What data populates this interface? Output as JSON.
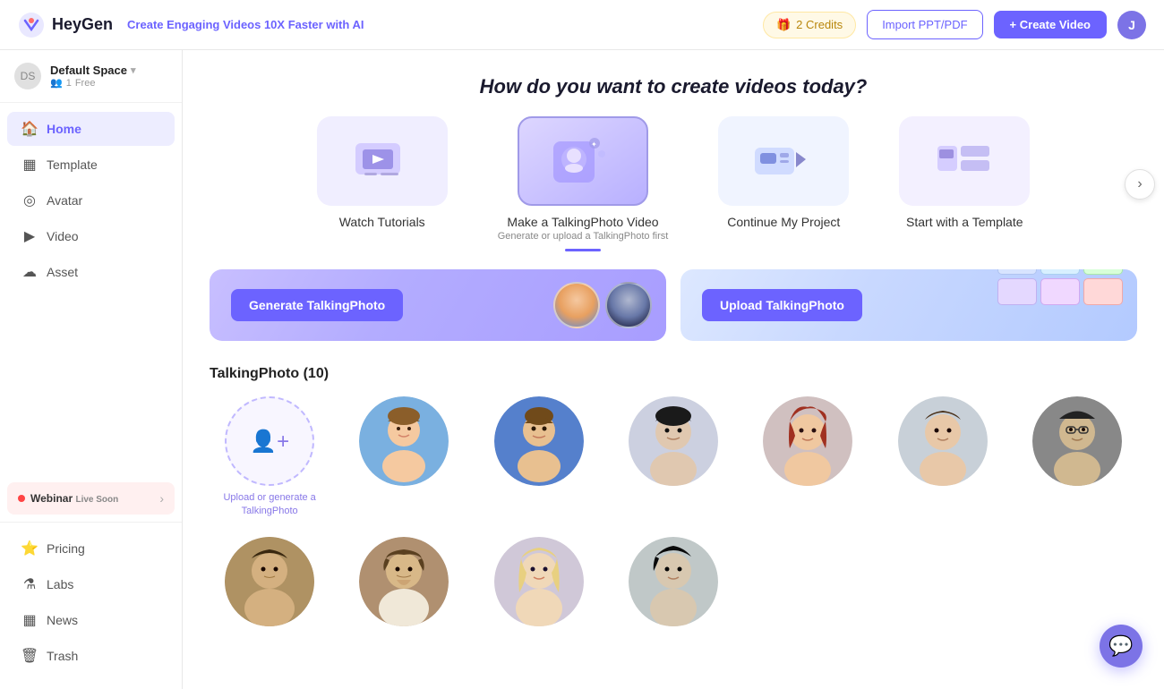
{
  "header": {
    "logo_text": "HeyGen",
    "tagline_prefix": "Create Engaging ",
    "tagline_highlight": "Videos 10X Faster with AI",
    "credits_count": "2 Credits",
    "import_btn_label": "Import PPT/PDF",
    "create_btn_label": "+ Create Video",
    "avatar_initial": "J"
  },
  "sidebar": {
    "workspace_name": "Default Space",
    "workspace_members": "1",
    "workspace_plan": "Free",
    "nav_items": [
      {
        "id": "home",
        "label": "Home",
        "icon": "🏠",
        "active": true
      },
      {
        "id": "template",
        "label": "Template",
        "icon": "▦"
      },
      {
        "id": "avatar",
        "label": "Avatar",
        "icon": "◎"
      },
      {
        "id": "video",
        "label": "Video",
        "icon": "▶"
      },
      {
        "id": "asset",
        "label": "Asset",
        "icon": "☁"
      }
    ],
    "webinar": {
      "label": "Webinar",
      "sublabel": "Live Soon"
    },
    "bottom_items": [
      {
        "id": "pricing",
        "label": "Pricing",
        "icon": "⭐"
      },
      {
        "id": "labs",
        "label": "Labs",
        "icon": "⚗"
      },
      {
        "id": "news",
        "label": "News",
        "icon": "▦"
      },
      {
        "id": "trash",
        "label": "Trash",
        "icon": "🗑"
      }
    ]
  },
  "main": {
    "question": "How do you want to create videos today?",
    "cards": [
      {
        "id": "tutorials",
        "label": "Watch Tutorials",
        "sublabel": ""
      },
      {
        "id": "talking-photo",
        "label": "Make a TalkingPhoto Video",
        "sublabel": "Generate or upload a TalkingPhoto first",
        "active": true
      },
      {
        "id": "continue",
        "label": "Continue My Project",
        "sublabel": ""
      },
      {
        "id": "template",
        "label": "Start with a Template",
        "sublabel": ""
      }
    ],
    "action_cards": [
      {
        "id": "generate",
        "btn_label": "Generate TalkingPhoto"
      },
      {
        "id": "upload",
        "btn_label": "Upload TalkingPhoto"
      }
    ],
    "section_title": "TalkingPhoto (10)",
    "upload_label": "Upload or generate a TalkingPhoto",
    "avatars_row1": [
      {
        "id": "upload-placeholder",
        "type": "upload"
      },
      {
        "id": "av1",
        "type": "cartoon-1"
      },
      {
        "id": "av2",
        "type": "cartoon-2"
      },
      {
        "id": "av3",
        "type": "dark-1"
      },
      {
        "id": "av4",
        "type": "grad-4"
      },
      {
        "id": "av5",
        "type": "grad-5"
      },
      {
        "id": "av6",
        "type": "grad-6"
      }
    ],
    "avatars_row2": [
      {
        "id": "av7",
        "type": "mona"
      },
      {
        "id": "av8",
        "type": "shakes"
      },
      {
        "id": "av9",
        "type": "blond"
      },
      {
        "id": "av10",
        "type": "dark-young"
      }
    ]
  }
}
